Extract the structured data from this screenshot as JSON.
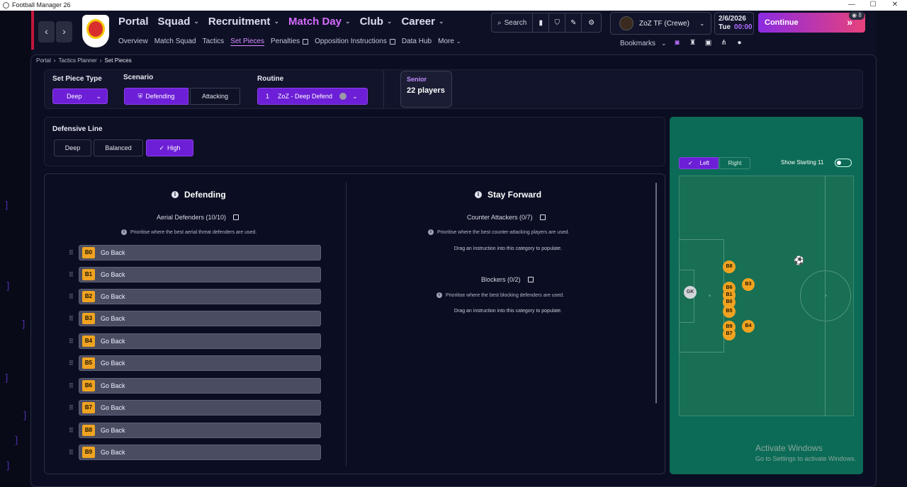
{
  "window": {
    "title": "Football Manager 26",
    "controls": [
      "—",
      "☐",
      "✕"
    ]
  },
  "nav": {
    "main": [
      {
        "label": "Portal",
        "active": false
      },
      {
        "label": "Squad",
        "active": false
      },
      {
        "label": "Recruitment",
        "active": false
      },
      {
        "label": "Match Day",
        "active": true
      },
      {
        "label": "Club",
        "active": false
      },
      {
        "label": "Career",
        "active": false
      }
    ],
    "sub": [
      {
        "label": "Overview"
      },
      {
        "label": "Match Squad"
      },
      {
        "label": "Tactics"
      },
      {
        "label": "Set Pieces",
        "selected": true
      },
      {
        "label": "Penalties",
        "external": true
      },
      {
        "label": "Opposition Instructions",
        "external": true
      },
      {
        "label": "Data Hub"
      },
      {
        "label": "More",
        "dropdown": true
      }
    ]
  },
  "toolbar": {
    "search_label": "Search"
  },
  "manager": {
    "name": "ZoZ TF (Crewe)"
  },
  "date": {
    "date": "2/6/2026",
    "day": "Tue",
    "time": "00:00"
  },
  "continue_label": "Continue",
  "badge_count": "8",
  "bookmarks_label": "Bookmarks",
  "breadcrumb": [
    "Portal",
    "Tactics Planner",
    "Set Pieces"
  ],
  "setpiece": {
    "type_label": "Set Piece Type",
    "type_value": "Deep",
    "scenario_label": "Scenario",
    "scenario_options": [
      "Defending",
      "Attacking"
    ],
    "scenario_selected": "Defending",
    "routine_label": "Routine",
    "routine_number": "1",
    "routine_value": "ZoZ - Deep Defend",
    "squad_label": "Senior",
    "squad_value": "22 players"
  },
  "defensive_line": {
    "label": "Defensive Line",
    "options": [
      "Deep",
      "Balanced",
      "High"
    ],
    "selected": "High"
  },
  "defending": {
    "title": "Defending",
    "aerial_label": "Aerial Defenders (10/10)",
    "aerial_hint": "Prioritise where the best aerial threat defenders are used.",
    "rows": [
      {
        "tag": "B0",
        "text": "Go Back"
      },
      {
        "tag": "B1",
        "text": "Go Back"
      },
      {
        "tag": "B2",
        "text": "Go Back"
      },
      {
        "tag": "B3",
        "text": "Go Back"
      },
      {
        "tag": "B4",
        "text": "Go Back"
      },
      {
        "tag": "B5",
        "text": "Go Back"
      },
      {
        "tag": "B6",
        "text": "Go Back"
      },
      {
        "tag": "B7",
        "text": "Go Back"
      },
      {
        "tag": "B8",
        "text": "Go Back"
      },
      {
        "tag": "B9",
        "text": "Go Back"
      }
    ]
  },
  "stay_forward": {
    "title": "Stay Forward",
    "counter_label": "Counter Attackers (0/7)",
    "counter_hint": "Prioritise where the best counter-attacking players are used.",
    "counter_drag": "Drag an instruction into this category to populate.",
    "blockers_label": "Blockers (0/2)",
    "blockers_hint": "Prioritise where the best blocking defenders are used.",
    "blockers_drag": "Drag an instruction into this category to populate."
  },
  "pitch": {
    "side_options": [
      "Left",
      "Right"
    ],
    "side_selected": "Left",
    "show_starting_label": "Show Starting 11",
    "players": [
      "GK",
      "B8",
      "B3",
      "B6",
      "B1",
      "B0",
      "B5",
      "B9",
      "B7",
      "B4"
    ],
    "colors": {
      "player": "#f0a320",
      "gk": "#d2d4dc",
      "pitch": "#186f53"
    }
  },
  "watermark": {
    "line1": "Activate Windows",
    "line2": "Go to Settings to activate Windows."
  },
  "colors": {
    "accent": "#6c1fd6",
    "accent_text": "#d66bff",
    "continue_from": "#8b2be2",
    "continue_to": "#e7417c"
  }
}
